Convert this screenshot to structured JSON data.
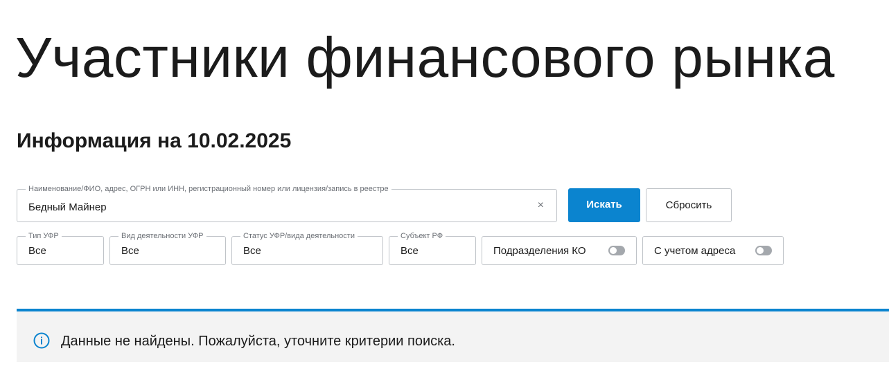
{
  "page": {
    "title": "Участники финансового рынка",
    "info_date": "Информация на 10.02.2025"
  },
  "search": {
    "legend": "Наименование/ФИО, адрес, ОГРН или ИНН, регистрационный номер или лицензия/запись в реестре",
    "value": "Бедный Майнер",
    "clear_icon": "×",
    "search_button": "Искать",
    "reset_button": "Сбросить"
  },
  "filters": {
    "type": {
      "legend": "Тип УФР",
      "value": "Все"
    },
    "activity": {
      "legend": "Вид деятельности УФР",
      "value": "Все"
    },
    "status": {
      "legend": "Статус УФР/вида деятельности",
      "value": "Все"
    },
    "region": {
      "legend": "Субъект РФ",
      "value": "Все"
    },
    "toggle_ko": {
      "label": "Подразделения КО",
      "enabled": false
    },
    "toggle_address": {
      "label": "С учетом адреса",
      "enabled": false
    }
  },
  "notice": {
    "icon": "info-icon",
    "message": "Данные не найдены. Пожалуйста, уточните критерии поиска."
  },
  "colors": {
    "accent": "#0b84cf",
    "notice_bg": "#f3f3f3",
    "border": "#bfc3c8"
  }
}
